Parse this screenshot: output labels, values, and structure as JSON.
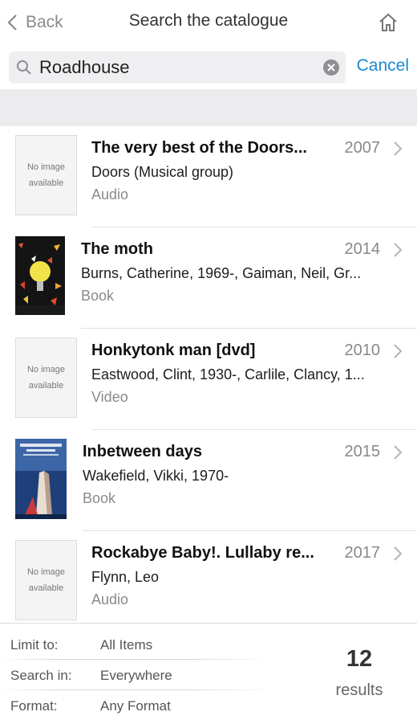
{
  "nav": {
    "back_label": "Back",
    "title": "Search the catalogue",
    "home_icon": "home-icon"
  },
  "search": {
    "value": "Roadhouse",
    "cancel_label": "Cancel"
  },
  "results": [
    {
      "title": "The very best of the Doors...",
      "year": "2007",
      "author": "Doors (Musical group)",
      "format": "Audio",
      "thumb": "No image available"
    },
    {
      "title": "The moth",
      "year": "2014",
      "author": "Burns, Catherine, 1969-, Gaiman, Neil, Gr...",
      "format": "Book",
      "thumb": ""
    },
    {
      "title": "Honkytonk man [dvd]",
      "year": "2010",
      "author": "Eastwood, Clint, 1930-, Carlile, Clancy, 1...",
      "format": "Video",
      "thumb": "No image available"
    },
    {
      "title": "Inbetween days",
      "year": "2015",
      "author": "Wakefield, Vikki, 1970-",
      "format": "Book",
      "thumb": ""
    },
    {
      "title": "Rockabye Baby!. Lullaby re...",
      "year": "2017",
      "author": "Flynn, Leo",
      "format": "Audio",
      "thumb": "No image available"
    }
  ],
  "filters": {
    "limit_label": "Limit to:",
    "limit_value": "All Items",
    "search_in_label": "Search in:",
    "search_in_value": "Everywhere",
    "format_label": "Format:",
    "format_value": "Any Format"
  },
  "summary": {
    "count": "12",
    "count_label": "results"
  },
  "colors": {
    "accent": "#1a8ad5",
    "band": "#ececee"
  }
}
